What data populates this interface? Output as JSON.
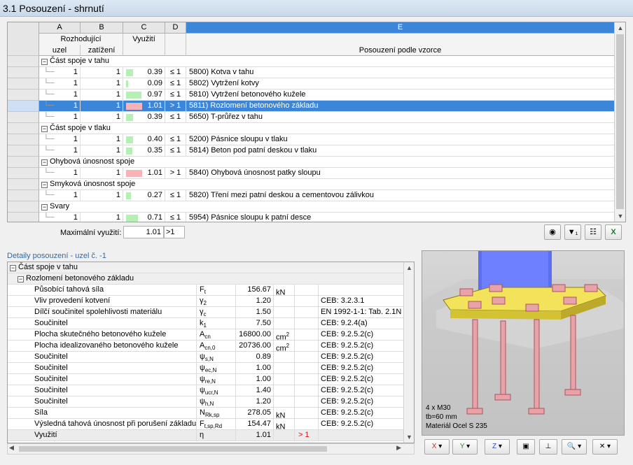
{
  "title": "3.1 Posouzení - shrnutí",
  "columns": {
    "letters": [
      "A",
      "B",
      "C",
      "D",
      "E"
    ],
    "h1": {
      "ab": "Rozhodující",
      "c": "Využití"
    },
    "h2": {
      "a": "uzel",
      "b": "zatížení",
      "e": "Posouzení podle vzorce"
    }
  },
  "groups": [
    {
      "name": "Část spoje v tahu",
      "rows": [
        {
          "node": "1",
          "load": "1",
          "util": "0.39",
          "cmp": "≤ 1",
          "ratio": 0.39,
          "ok": true,
          "formula": "5800) Kotva v tahu"
        },
        {
          "node": "1",
          "load": "1",
          "util": "0.09",
          "cmp": "≤ 1",
          "ratio": 0.09,
          "ok": true,
          "formula": "5802) Vytržení kotvy"
        },
        {
          "node": "1",
          "load": "1",
          "util": "0.97",
          "cmp": "≤ 1",
          "ratio": 0.97,
          "ok": true,
          "formula": "5810) Vytržení betonového kužele"
        },
        {
          "node": "1",
          "load": "1",
          "util": "1.01",
          "cmp": "> 1",
          "ratio": 1.01,
          "ok": false,
          "selected": true,
          "formula": "5811) Rozlomení betonového základu"
        },
        {
          "node": "1",
          "load": "1",
          "util": "0.39",
          "cmp": "≤ 1",
          "ratio": 0.39,
          "ok": true,
          "formula": "5650) T-průřez v tahu"
        }
      ]
    },
    {
      "name": "Část spoje v tlaku",
      "rows": [
        {
          "node": "1",
          "load": "1",
          "util": "0.40",
          "cmp": "≤ 1",
          "ratio": 0.4,
          "ok": true,
          "formula": "5200) Pásnice sloupu v tlaku"
        },
        {
          "node": "1",
          "load": "1",
          "util": "0.35",
          "cmp": "≤ 1",
          "ratio": 0.35,
          "ok": true,
          "formula": "5814) Beton pod patní deskou v tlaku"
        }
      ]
    },
    {
      "name": "Ohybová únosnost spoje",
      "rows": [
        {
          "node": "1",
          "load": "1",
          "util": "1.01",
          "cmp": "> 1",
          "ratio": 1.01,
          "ok": false,
          "formula": "5840) Ohybová únosnost patky sloupu"
        }
      ]
    },
    {
      "name": "Smyková únosnost spoje",
      "rows": [
        {
          "node": "1",
          "load": "1",
          "util": "0.27",
          "cmp": "≤ 1",
          "ratio": 0.27,
          "ok": true,
          "formula": "5820) Tření mezi patní deskou a cementovou zálivkou"
        }
      ]
    },
    {
      "name": "Svary",
      "rows": [
        {
          "node": "1",
          "load": "1",
          "util": "0.71",
          "cmp": "≤ 1",
          "ratio": 0.71,
          "ok": true,
          "formula": "5954) Pásnice sloupu k patní desce"
        }
      ]
    }
  ],
  "max": {
    "label": "Maximální využití:",
    "value": "1.01",
    "cmp": ">1"
  },
  "toolbar": {
    "eye": "◉",
    "filter": "▼₁",
    "chart": "☷",
    "excel": "X"
  },
  "details": {
    "title": "Detaily posouzení  -  uzel č. -1",
    "group": "Část spoje v tahu",
    "subgroup": "Rozlomení betonového základu",
    "rows": [
      {
        "name": "Působící tahová síla",
        "sym": "F",
        "sub": "t",
        "val": "156.67",
        "unit": "kN",
        "ref": ""
      },
      {
        "name": "Vliv provedení kotvení",
        "sym": "γ",
        "sub": "2",
        "val": "1.20",
        "unit": "",
        "ref": "CEB: 3.2.3.1"
      },
      {
        "name": "Dílčí součinitel spolehlivosti materiálu",
        "sym": "γ",
        "sub": "c",
        "val": "1.50",
        "unit": "",
        "ref": "EN 1992-1-1: Tab. 2.1N"
      },
      {
        "name": "Součinitel",
        "sym": "k",
        "sub": "1",
        "val": "7.50",
        "unit": "",
        "ref": "CEB: 9.2.4(a)"
      },
      {
        "name": "Plocha skutečného betonového kužele",
        "sym": "A",
        "sub": "cn",
        "val": "16800.00",
        "unit": "cm",
        "sup": "2",
        "ref": "CEB: 9.2.5.2(c)"
      },
      {
        "name": "Plocha idealizovaného betonového kužele",
        "sym": "A",
        "sub": "cn,0",
        "val": "20736.00",
        "unit": "cm",
        "sup": "2",
        "ref": "CEB: 9.2.5.2(c)"
      },
      {
        "name": "Součinitel",
        "sym": "ψ",
        "sub": "s,N",
        "val": "0.89",
        "unit": "",
        "ref": "CEB: 9.2.5.2(c)"
      },
      {
        "name": "Součinitel",
        "sym": "ψ",
        "sub": "ec,N",
        "val": "1.00",
        "unit": "",
        "ref": "CEB: 9.2.5.2(c)"
      },
      {
        "name": "Součinitel",
        "sym": "ψ",
        "sub": "re,N",
        "val": "1.00",
        "unit": "",
        "ref": "CEB: 9.2.5.2(c)"
      },
      {
        "name": "Součinitel",
        "sym": "ψ",
        "sub": "ucr,N",
        "val": "1.40",
        "unit": "",
        "ref": "CEB: 9.2.5.2(c)"
      },
      {
        "name": "Součinitel",
        "sym": "ψ",
        "sub": "h,N",
        "val": "1.20",
        "unit": "",
        "ref": "CEB: 9.2.5.2(c)"
      },
      {
        "name": "Síla",
        "sym": "N",
        "sub": "Rk,sp",
        "val": "278.05",
        "unit": "kN",
        "ref": "CEB: 9.2.5.2(c)"
      },
      {
        "name": "Výsledná tahová únosnost při porušení základu",
        "sym": "F",
        "sub": "t,sp,Rd",
        "val": "154.47",
        "unit": "kN",
        "ref": "CEB: 9.2.5.2(c)"
      },
      {
        "name": "Využití",
        "sym": "η",
        "sub": "",
        "val": "1.01",
        "unit": "",
        "ref": "",
        "cmp": "> 1"
      }
    ]
  },
  "view": {
    "lines": [
      "4 x M30",
      "tb=60 mm",
      "Materiál Ocel S 235"
    ]
  },
  "viewtools": [
    "X",
    "Y",
    "Z",
    "▣",
    "⊥",
    "🔍",
    "✕"
  ],
  "colors": {
    "ok": "#b4efb4",
    "fail": "#f6b3b8",
    "selected": "#3b86d8"
  }
}
